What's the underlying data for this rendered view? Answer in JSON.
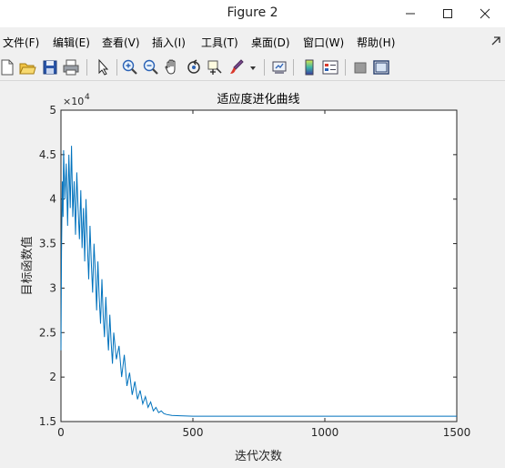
{
  "window": {
    "title": "Figure 2"
  },
  "menu": [
    "文件(F)",
    "编辑(E)",
    "查看(V)",
    "插入(I)",
    "工具(T)",
    "桌面(D)",
    "窗口(W)",
    "帮助(H)"
  ],
  "toolbar_icons": [
    "new-figure-icon",
    "open-file-icon",
    "save-icon",
    "print-icon",
    "select-arrow-icon",
    "zoom-in-icon",
    "zoom-out-icon",
    "pan-hand-icon",
    "rotate-3d-icon",
    "data-cursor-icon",
    "brush-icon",
    "brush-dropdown-icon",
    "link-plot-icon",
    "colorbar-icon",
    "legend-icon",
    "hide-plot-tools-icon",
    "show-plot-tools-icon"
  ],
  "chart_data": {
    "type": "line",
    "title": "适应度进化曲线",
    "xlabel": "迭代次数",
    "ylabel": "目标函数值",
    "y_exponent_label": "×10",
    "y_exponent": "4",
    "xlim": [
      0,
      1500
    ],
    "ylim": [
      15000,
      50000
    ],
    "xticks": [
      0,
      500,
      1000,
      1500
    ],
    "yticks": [
      15000,
      20000,
      25000,
      30000,
      35000,
      40000,
      45000,
      50000
    ],
    "yticklabels": [
      "1.5",
      "2",
      "2.5",
      "3",
      "3.5",
      "4",
      "4.5",
      "5"
    ],
    "line_color": "#0072bd",
    "grid": false,
    "series": [
      {
        "x": [
          0,
          2,
          5,
          8,
          10,
          15,
          20,
          25,
          30,
          35,
          40,
          45,
          50,
          55,
          60,
          65,
          70,
          75,
          80,
          85,
          90,
          95,
          100,
          105,
          110,
          115,
          120,
          125,
          130,
          135,
          140,
          145,
          150,
          155,
          160,
          165,
          170,
          175,
          180,
          185,
          190,
          195,
          200,
          210,
          220,
          230,
          240,
          250,
          260,
          270,
          280,
          290,
          300,
          310,
          320,
          330,
          340,
          350,
          360,
          370,
          380,
          390,
          400,
          420,
          450,
          500,
          550,
          600,
          700,
          800,
          900,
          1000,
          1100,
          1200,
          1300,
          1400,
          1500
        ],
        "y": [
          23000,
          34000,
          42000,
          38000,
          45500,
          40000,
          44000,
          37000,
          45000,
          39000,
          46000,
          38000,
          42000,
          36000,
          43000,
          39000,
          35500,
          41000,
          34500,
          39000,
          33000,
          40000,
          35000,
          31000,
          37000,
          33000,
          29500,
          35000,
          32000,
          27500,
          33000,
          29000,
          26000,
          31000,
          27000,
          24500,
          29000,
          25500,
          23000,
          27000,
          24000,
          21500,
          25000,
          22000,
          23500,
          20000,
          22500,
          19000,
          20500,
          18000,
          19500,
          17500,
          18500,
          17000,
          17800,
          16600,
          17200,
          16200,
          16600,
          16000,
          16200,
          15900,
          15800,
          15700,
          15650,
          15600,
          15600,
          15600,
          15600,
          15600,
          15600,
          15600,
          15600,
          15600,
          15600,
          15600,
          15600
        ]
      }
    ]
  }
}
